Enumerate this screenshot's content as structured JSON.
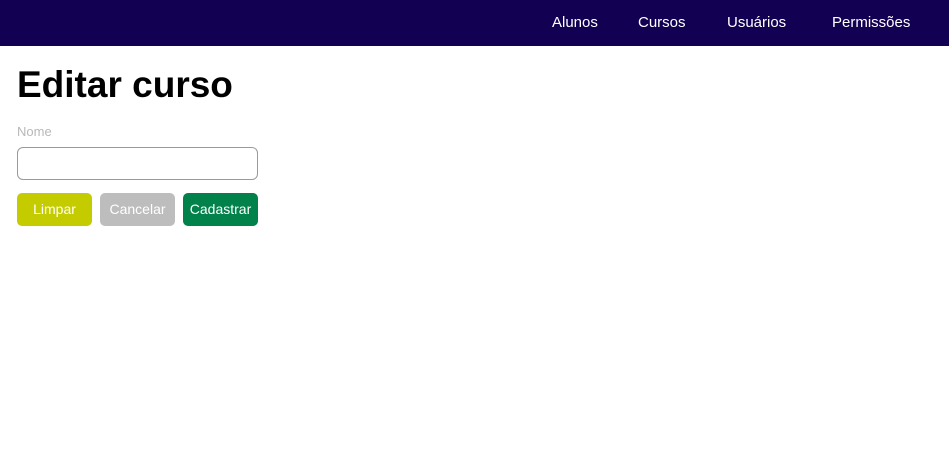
{
  "nav": {
    "items": [
      {
        "label": "Alunos"
      },
      {
        "label": "Cursos"
      },
      {
        "label": "Usuários"
      },
      {
        "label": "Permissões"
      }
    ],
    "background": "#120052"
  },
  "page": {
    "title": "Editar curso"
  },
  "form": {
    "name_label": "Nome",
    "name_value": "",
    "buttons": {
      "clear_label": "Limpar",
      "cancel_label": "Cancelar",
      "submit_label": "Cadastrar"
    },
    "colors": {
      "clear": "#c4cc00",
      "cancel": "#bdbdbd",
      "submit": "#00824a"
    }
  }
}
